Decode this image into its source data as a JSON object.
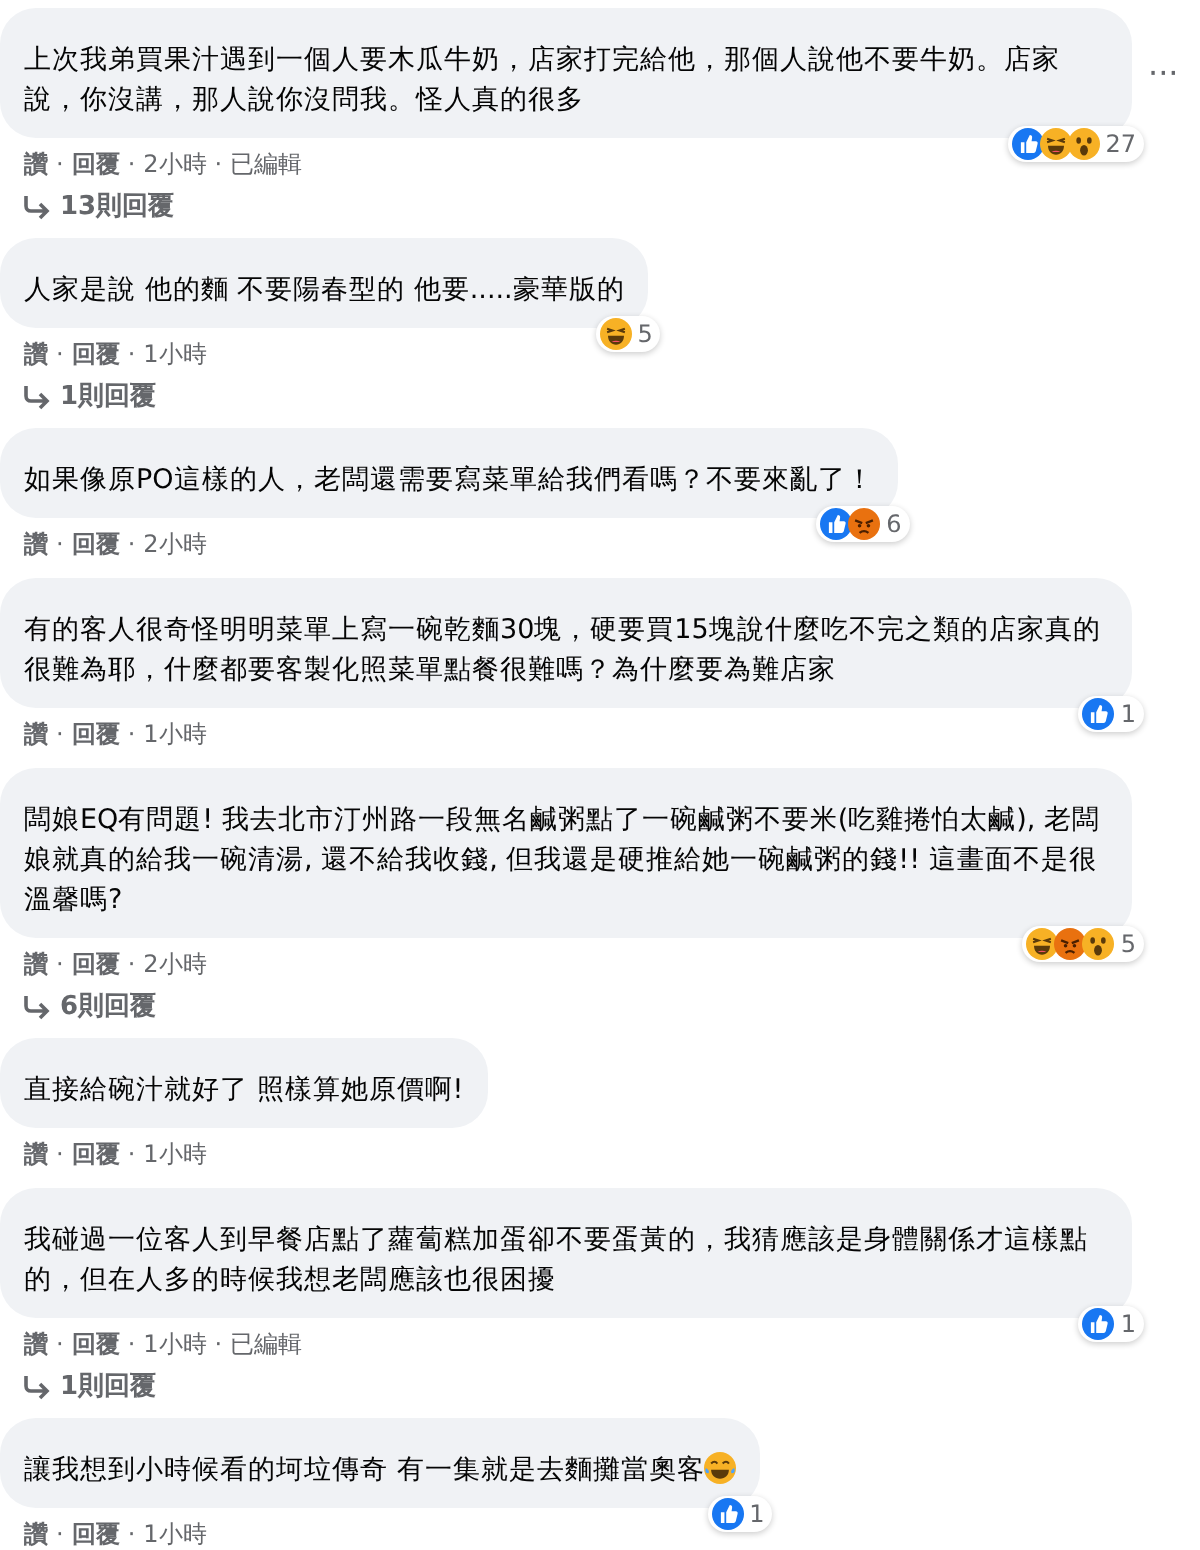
{
  "comments": [
    {
      "text": "上次我弟買果汁遇到一個人要木瓜牛奶，店家打完給他，那個人說他不要牛奶。店家說，你沒講，那人說你沒問我。怪人真的很多",
      "more_menu": "···",
      "reactions": [
        {
          "kind": "like"
        },
        {
          "kind": "haha"
        },
        {
          "kind": "wow"
        }
      ],
      "reaction_count": "27",
      "actions": [
        {
          "kind": "like",
          "label": "讚"
        },
        {
          "kind": "dot",
          "label": "·"
        },
        {
          "kind": "reply",
          "label": "回覆"
        },
        {
          "kind": "dot",
          "label": "·"
        },
        {
          "kind": "time",
          "label": "2小時"
        },
        {
          "kind": "dot",
          "label": "·"
        },
        {
          "kind": "edited",
          "label": "已編輯"
        }
      ],
      "replies": "13則回覆"
    },
    {
      "text": "人家是說 他的麵 不要陽春型的 他要.....豪華版的",
      "reactions": [
        {
          "kind": "haha"
        }
      ],
      "reaction_count": "5",
      "actions": [
        {
          "kind": "like",
          "label": "讚"
        },
        {
          "kind": "dot",
          "label": "·"
        },
        {
          "kind": "reply",
          "label": "回覆"
        },
        {
          "kind": "dot",
          "label": "·"
        },
        {
          "kind": "time",
          "label": "1小時"
        }
      ],
      "replies": "1則回覆"
    },
    {
      "text": "如果像原PO這樣的人，老闆還需要寫菜單給我們看嗎？不要來亂了！",
      "reactions": [
        {
          "kind": "like"
        },
        {
          "kind": "angry"
        }
      ],
      "reaction_count": "6",
      "actions": [
        {
          "kind": "like",
          "label": "讚"
        },
        {
          "kind": "dot",
          "label": "·"
        },
        {
          "kind": "reply",
          "label": "回覆"
        },
        {
          "kind": "dot",
          "label": "·"
        },
        {
          "kind": "time",
          "label": "2小時"
        }
      ]
    },
    {
      "text": "有的客人很奇怪明明菜單上寫一碗乾麵30塊，硬要買15塊說什麼吃不完之類的店家真的很難為耶，什麼都要客製化照菜單點餐很難嗎？為什麼要為難店家",
      "reactions": [
        {
          "kind": "like"
        }
      ],
      "reaction_count": "1",
      "actions": [
        {
          "kind": "like",
          "label": "讚"
        },
        {
          "kind": "dot",
          "label": "·"
        },
        {
          "kind": "reply",
          "label": "回覆"
        },
        {
          "kind": "dot",
          "label": "·"
        },
        {
          "kind": "time",
          "label": "1小時"
        }
      ]
    },
    {
      "text": "闆娘EQ有問題! 我去北市汀州路一段無名鹹粥點了一碗鹹粥不要米(吃雞捲怕太鹹), 老闆娘就真的給我一碗清湯, 還不給我收錢, 但我還是硬推給她一碗鹹粥的錢!! 這畫面不是很溫馨嗎?",
      "reactions": [
        {
          "kind": "haha"
        },
        {
          "kind": "angry"
        },
        {
          "kind": "wow"
        }
      ],
      "reaction_count": "5",
      "actions": [
        {
          "kind": "like",
          "label": "讚"
        },
        {
          "kind": "dot",
          "label": "·"
        },
        {
          "kind": "reply",
          "label": "回覆"
        },
        {
          "kind": "dot",
          "label": "·"
        },
        {
          "kind": "time",
          "label": "2小時"
        }
      ],
      "replies": "6則回覆"
    },
    {
      "text": "直接給碗汁就好了 照樣算她原價啊!",
      "actions": [
        {
          "kind": "like",
          "label": "讚"
        },
        {
          "kind": "dot",
          "label": "·"
        },
        {
          "kind": "reply",
          "label": "回覆"
        },
        {
          "kind": "dot",
          "label": "·"
        },
        {
          "kind": "time",
          "label": "1小時"
        }
      ]
    },
    {
      "text": "我碰過一位客人到早餐店點了蘿蔔糕加蛋卻不要蛋黃的，我猜應該是身體關係才這樣點的，但在人多的時候我想老闆應該也很困擾",
      "reactions": [
        {
          "kind": "like"
        }
      ],
      "reaction_count": "1",
      "actions": [
        {
          "kind": "like",
          "label": "讚"
        },
        {
          "kind": "dot",
          "label": "·"
        },
        {
          "kind": "reply",
          "label": "回覆"
        },
        {
          "kind": "dot",
          "label": "·"
        },
        {
          "kind": "time",
          "label": "1小時"
        },
        {
          "kind": "dot",
          "label": "·"
        },
        {
          "kind": "edited",
          "label": "已編輯"
        }
      ],
      "replies": "1則回覆"
    },
    {
      "text": "讓我想到小時候看的坷垃傳奇 有一集就是去麵攤當奧客",
      "trailing_emoji": {
        "kind": "laughing"
      },
      "reactions": [
        {
          "kind": "like"
        }
      ],
      "reaction_count": "1",
      "actions": [
        {
          "kind": "like",
          "label": "讚"
        },
        {
          "kind": "dot",
          "label": "·"
        },
        {
          "kind": "reply",
          "label": "回覆"
        },
        {
          "kind": "dot",
          "label": "·"
        },
        {
          "kind": "time",
          "label": "1小時"
        }
      ]
    }
  ]
}
